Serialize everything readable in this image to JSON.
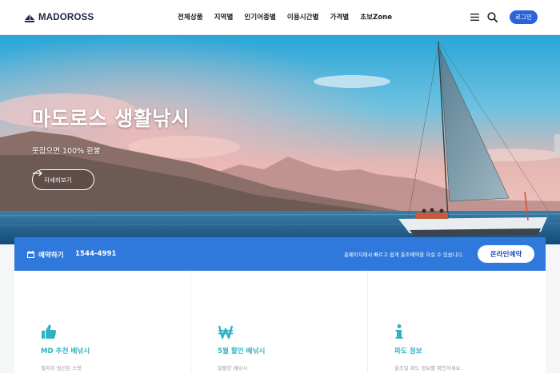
{
  "header": {
    "logo_text": "MADOROSS",
    "nav": [
      "전체상품",
      "지역별",
      "인기어종별",
      "이용시간별",
      "가격별",
      "초보Zone"
    ],
    "login_label": "로그인"
  },
  "hero": {
    "title": "마도로스 생활낚시",
    "subtitle": "못잡으면 100% 환불",
    "button_label": "자세히보기"
  },
  "booking": {
    "label": "예약하기",
    "phone": "1544-4991",
    "notice": "홈페이지에서 빠르고 쉽게 출조예약을 하실 수 있습니다.",
    "button_label": "온라인예약"
  },
  "cards": [
    {
      "icon": "thumbs-up-icon",
      "title": "MD 추천 배낚시",
      "desc": "철저히 엄선된 스팟"
    },
    {
      "icon": "won-icon",
      "title": "5월 할인 배낚시",
      "desc": "알뜰한 배낚시"
    },
    {
      "icon": "info-icon",
      "title": "파도 정보",
      "desc": "출조일 파도 정보를 확인하세요."
    }
  ],
  "colors": {
    "brand_navy": "#1b2447",
    "accent_blue": "#2b63d9",
    "booking_bar": "#2f78dc",
    "card_teal": "#2fb3c4"
  }
}
